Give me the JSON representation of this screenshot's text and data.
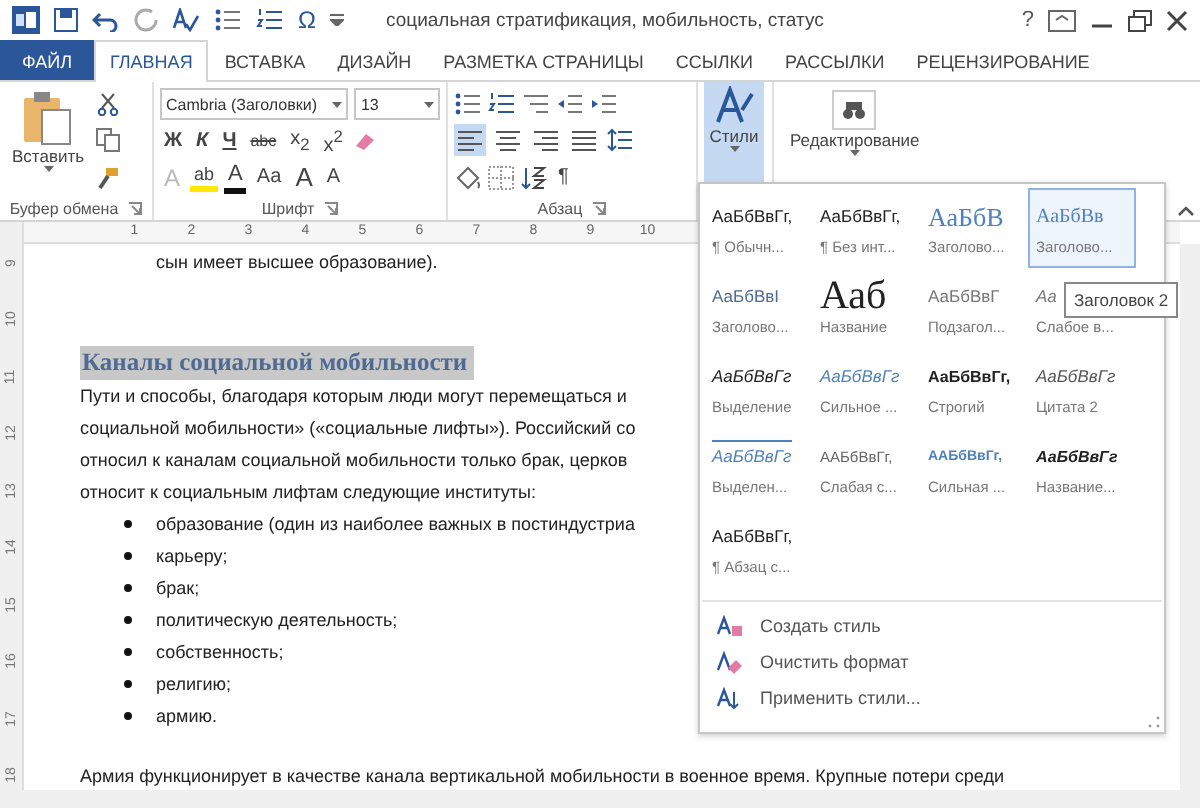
{
  "window": {
    "title": "социальная стратификация, мобильность, статус",
    "symbol": "Ω",
    "help": "?"
  },
  "tabs": [
    {
      "label": "ФАЙЛ",
      "kind": "file",
      "selected": false
    },
    {
      "label": "ГЛАВНАЯ",
      "kind": "tab",
      "selected": true
    },
    {
      "label": "ВСТАВКА",
      "kind": "tab",
      "selected": false
    },
    {
      "label": "ДИЗАЙН",
      "kind": "tab",
      "selected": false
    },
    {
      "label": "РАЗМЕТКА СТРАНИЦЫ",
      "kind": "tab",
      "selected": false
    },
    {
      "label": "ССЫЛКИ",
      "kind": "tab",
      "selected": false
    },
    {
      "label": "РАССЫЛКИ",
      "kind": "tab",
      "selected": false
    },
    {
      "label": "РЕЦЕНЗИРОВАНИЕ",
      "kind": "tab",
      "selected": false
    }
  ],
  "ribbon": {
    "clipboard": {
      "paste_label": "Вставить",
      "group_label": "Буфер обмена"
    },
    "font": {
      "font_name": "Cambria (Заголовки)",
      "font_size": "13",
      "format_buttons": [
        {
          "label": "Ж",
          "kind": "bold"
        },
        {
          "label": "К",
          "kind": "italic"
        },
        {
          "label": "Ч",
          "kind": "underline"
        },
        {
          "label": "abc",
          "kind": "strike"
        },
        {
          "label": "x$_{2}$",
          "kind": "plain"
        },
        {
          "label": "x$^{2}$",
          "kind": "plain"
        }
      ],
      "effect_buttons": [
        {
          "label": "A",
          "kind": "effects"
        },
        {
          "label": "ab",
          "kind": "highlight"
        },
        {
          "label": "A",
          "kind": "color"
        },
        {
          "label": "Аа",
          "kind": "case"
        },
        {
          "label": "A",
          "kind": "grow"
        },
        {
          "label": "A",
          "kind": "shrink"
        }
      ],
      "group_label": "Шрифт"
    },
    "paragraph": {
      "alignment": [
        {
          "selected": true
        },
        {
          "selected": false
        },
        {
          "selected": false
        },
        {
          "selected": false
        }
      ],
      "pilcrow": "¶",
      "group_label": "Абзац"
    },
    "styles_button": {
      "label": "Стили",
      "expanded": true
    },
    "editing_button": {
      "label": "Редактирование"
    }
  },
  "ruler": {
    "marks": [
      "1",
      "2",
      "3",
      "4",
      "5",
      "6",
      "7",
      "8",
      "9",
      "10"
    ]
  },
  "vertical_ruler": {
    "marks": [
      "9",
      "10",
      "11",
      "12",
      "13",
      "14",
      "15",
      "16",
      "17",
      "18"
    ]
  },
  "document": {
    "blocks": [
      {
        "kind": "continuation",
        "text": "сын имеет высшее образование)."
      },
      {
        "kind": "heading",
        "text": "Каналы социальной мобильности"
      },
      {
        "kind": "line",
        "text": "Пути и способы, благодаря которым люди могут перемещаться и"
      },
      {
        "kind": "line",
        "text": "социальной мобильности» («социальные лифты»). Российский со"
      },
      {
        "kind": "line",
        "text": "относил к каналам социальной мобильности только брак, церков"
      },
      {
        "kind": "line",
        "text": "относит к социальным лифтам следующие институты:"
      },
      {
        "kind": "bullet",
        "text": "образование (один из наиболее важных в постиндустриа"
      },
      {
        "kind": "bullet",
        "text": "карьеру;"
      },
      {
        "kind": "bullet",
        "text": "брак;"
      },
      {
        "kind": "bullet",
        "text": "политическую деятельность;"
      },
      {
        "kind": "bullet",
        "text": "собственность;"
      },
      {
        "kind": "bullet",
        "text": "религию;"
      },
      {
        "kind": "bullet",
        "text": "армию."
      },
      {
        "kind": "gap_line",
        "text": "Армия функционирует в качестве канала вертикальной мобильности в военное время. Крупные потери среди"
      }
    ]
  },
  "style_gallery": {
    "styles": [
      {
        "sample": "АаБбВвГг,",
        "name": "¶ Обычн...",
        "kind": "normal",
        "selected": false
      },
      {
        "sample": "АаБбВвГг,",
        "name": "¶ Без инт...",
        "kind": "normal",
        "selected": false
      },
      {
        "sample": "АаБбВ",
        "name": "Заголово...",
        "kind": "heading1",
        "selected": false
      },
      {
        "sample": "АаБбВв",
        "name": "Заголово...",
        "kind": "heading2",
        "selected": true
      },
      {
        "sample": "АаБбВвI",
        "name": "Заголово...",
        "kind": "heading3",
        "selected": false
      },
      {
        "sample": "Ааб",
        "name": "Название",
        "kind": "title",
        "selected": false
      },
      {
        "sample": "АаБбВвГ",
        "name": "Подзагол...",
        "kind": "subtitle",
        "selected": false
      },
      {
        "sample": "Аа",
        "name": "Слабое в...",
        "kind": "subtle_emphasis",
        "selected": false
      },
      {
        "sample": "АаБбВвГг",
        "name": "Выделение",
        "kind": "emphasis",
        "selected": false
      },
      {
        "sample": "АаБбВвГг",
        "name": "Сильное ...",
        "kind": "intense_emphasis",
        "selected": false
      },
      {
        "sample": "АаБбВвГг,",
        "name": "Строгий",
        "kind": "strong",
        "selected": false
      },
      {
        "sample": "АаБбВвГг",
        "name": "Цитата 2",
        "kind": "quote",
        "selected": false
      },
      {
        "sample": "АаБбВвГг",
        "name": "Выделен...",
        "kind": "intense_quote",
        "selected": false
      },
      {
        "sample": "ААБбВвГг,",
        "name": "Слабая с...",
        "kind": "subtle_reference",
        "selected": false
      },
      {
        "sample": "ААБбВвГг,",
        "name": "Сильная ...",
        "kind": "intense_reference",
        "selected": false
      },
      {
        "sample": "АаБбВвГг",
        "name": "Название...",
        "kind": "book_title",
        "selected": false
      },
      {
        "sample": "АаБбВвГг,",
        "name": "¶ Абзац с...",
        "kind": "normal",
        "selected": false
      }
    ],
    "commands": [
      {
        "label": "Создать стиль",
        "kind": "new"
      },
      {
        "label": "Очистить формат",
        "kind": "clear"
      },
      {
        "label": "Применить стили...",
        "kind": "apply"
      }
    ],
    "tooltip": "Заголовок 2"
  }
}
